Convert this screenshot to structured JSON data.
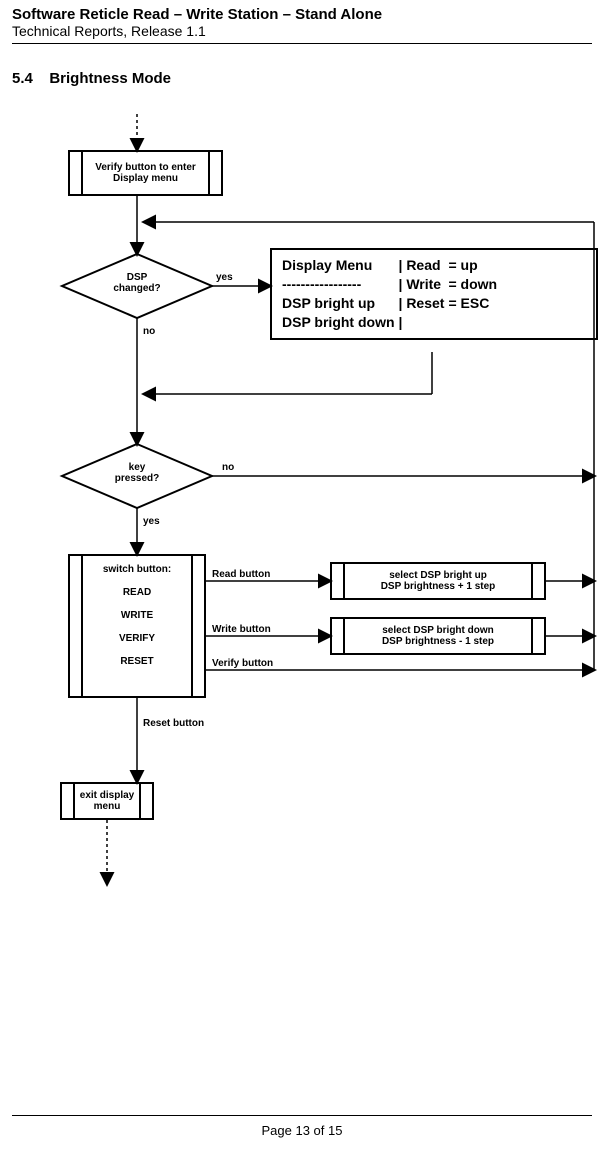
{
  "header": {
    "title": "Software Reticle Read – Write Station – Stand Alone",
    "subtitle": "Technical Reports, Release 1.1"
  },
  "section": {
    "number": "5.4",
    "title": "Brightness Mode"
  },
  "nodes": {
    "verify_entry": {
      "l1": "Verify button to enter",
      "l2": "Display menu"
    },
    "dsp_changed": {
      "l1": "DSP",
      "l2": "changed?"
    },
    "key_pressed": {
      "l1": "key",
      "l2": "pressed?"
    },
    "switch": {
      "title": "switch button:",
      "items": [
        "READ",
        "WRITE",
        "VERIFY",
        "RESET"
      ]
    },
    "exit": {
      "l1": "exit display",
      "l2": "menu"
    },
    "bright_up": {
      "l1": "select DSP bright up",
      "l2": "DSP brightness + 1 step"
    },
    "bright_down": {
      "l1": "select DSP bright down",
      "l2": "DSP brightness - 1 step"
    }
  },
  "labels": {
    "yes1": "yes",
    "no1": "no",
    "no2": "no",
    "yes2": "yes",
    "read_btn": "Read button",
    "write_btn": "Write button",
    "verify_btn": "Verify button",
    "reset_btn": "Reset button"
  },
  "display_menu": {
    "rows": [
      {
        "c1": "Display Menu",
        "c2": "| Read",
        "c3": "= up"
      },
      {
        "c1": "-----------------",
        "c2": "| Write",
        "c3": "= down"
      },
      {
        "c1": "DSP bright up",
        "c2": "| Reset",
        "c3": "=  ESC"
      },
      {
        "c1": "DSP bright down",
        "c2": "|",
        "c3": ""
      }
    ]
  },
  "footer": "Page 13 of 15"
}
